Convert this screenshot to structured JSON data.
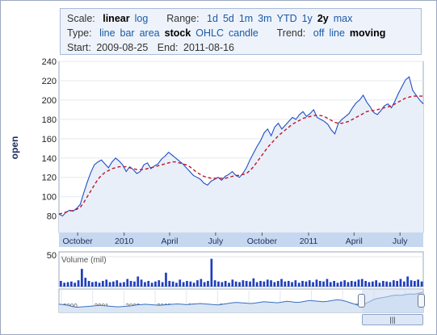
{
  "controls": {
    "scale": {
      "label": "Scale:",
      "options": [
        "linear",
        "log"
      ],
      "selected": "linear"
    },
    "range": {
      "label": "Range:",
      "options": [
        "1d",
        "5d",
        "1m",
        "3m",
        "YTD",
        "1y",
        "2y",
        "max"
      ],
      "selected": "2y"
    },
    "type": {
      "label": "Type:",
      "options": [
        "line",
        "bar",
        "area",
        "stock",
        "OHLC",
        "candle"
      ],
      "selected": "stock"
    },
    "trend": {
      "label": "Trend:",
      "options": [
        "off",
        "line",
        "moving"
      ],
      "selected": "moving"
    },
    "start": {
      "label": "Start:",
      "value": "2009-08-25"
    },
    "end": {
      "label": "End:",
      "value": "2011-08-16"
    }
  },
  "colors": {
    "price_line": "#1f4fc7",
    "price_fill": "#e9eff8",
    "trend_line": "#c0142c",
    "volume_bars": "#1f3fbf",
    "axis_band": "#c6d8f0",
    "navigator_line": "#3a6fc2",
    "navigator_fill": "#dbe6f5"
  },
  "chart_data": [
    {
      "type": "line",
      "title": "",
      "ylabel": "open",
      "ylim": [
        63,
        240
      ],
      "yticks": [
        80,
        100,
        120,
        140,
        160,
        180,
        200,
        220,
        240
      ],
      "xlim": [
        "2009-08-25",
        "2011-08-16"
      ],
      "xticks": [
        "October",
        "2010",
        "April",
        "July",
        "October",
        "2011",
        "April",
        "July"
      ],
      "x": [
        "2009-08-25",
        "2009-09-01",
        "2009-09-08",
        "2009-09-15",
        "2009-09-22",
        "2009-09-29",
        "2009-10-06",
        "2009-10-13",
        "2009-10-20",
        "2009-10-27",
        "2009-11-03",
        "2009-11-10",
        "2009-11-17",
        "2009-11-24",
        "2009-12-01",
        "2009-12-08",
        "2009-12-15",
        "2009-12-22",
        "2009-12-29",
        "2010-01-05",
        "2010-01-12",
        "2010-01-19",
        "2010-01-26",
        "2010-02-02",
        "2010-02-09",
        "2010-02-16",
        "2010-02-23",
        "2010-03-02",
        "2010-03-09",
        "2010-03-16",
        "2010-03-23",
        "2010-03-30",
        "2010-04-06",
        "2010-04-13",
        "2010-04-20",
        "2010-04-27",
        "2010-05-04",
        "2010-05-11",
        "2010-05-18",
        "2010-05-25",
        "2010-06-01",
        "2010-06-08",
        "2010-06-15",
        "2010-06-22",
        "2010-06-29",
        "2010-07-06",
        "2010-07-13",
        "2010-07-20",
        "2010-07-27",
        "2010-08-03",
        "2010-08-10",
        "2010-08-17",
        "2010-08-24",
        "2010-08-31",
        "2010-09-07",
        "2010-09-14",
        "2010-09-21",
        "2010-09-28",
        "2010-10-05",
        "2010-10-12",
        "2010-10-19",
        "2010-10-26",
        "2010-11-02",
        "2010-11-09",
        "2010-11-16",
        "2010-11-23",
        "2010-11-30",
        "2010-12-07",
        "2010-12-14",
        "2010-12-21",
        "2010-12-28",
        "2011-01-04",
        "2011-01-11",
        "2011-01-18",
        "2011-01-25",
        "2011-02-01",
        "2011-02-08",
        "2011-02-15",
        "2011-02-22",
        "2011-03-01",
        "2011-03-08",
        "2011-03-15",
        "2011-03-22",
        "2011-03-29",
        "2011-04-05",
        "2011-04-12",
        "2011-04-19",
        "2011-04-26",
        "2011-05-03",
        "2011-05-10",
        "2011-05-17",
        "2011-05-24",
        "2011-05-31",
        "2011-06-07",
        "2011-06-14",
        "2011-06-21",
        "2011-06-28",
        "2011-07-05",
        "2011-07-12",
        "2011-07-19",
        "2011-07-26",
        "2011-08-02",
        "2011-08-09",
        "2011-08-16"
      ],
      "series": [
        {
          "name": "",
          "role": "price",
          "values": [
            82,
            80,
            84,
            86,
            85,
            88,
            92,
            104,
            115,
            125,
            133,
            136,
            138,
            134,
            130,
            136,
            140,
            137,
            133,
            126,
            131,
            128,
            124,
            126,
            133,
            135,
            129,
            132,
            134,
            139,
            142,
            146,
            143,
            140,
            137,
            134,
            130,
            126,
            122,
            120,
            118,
            114,
            112,
            116,
            118,
            120,
            117,
            121,
            123,
            126,
            122,
            120,
            124,
            130,
            138,
            145,
            152,
            158,
            166,
            170,
            163,
            172,
            176,
            170,
            174,
            178,
            182,
            180,
            185,
            188,
            183,
            186,
            190,
            182,
            180,
            178,
            175,
            169,
            165,
            176,
            180,
            183,
            186,
            192,
            197,
            200,
            205,
            198,
            193,
            187,
            185,
            189,
            194,
            196,
            192,
            199,
            207,
            214,
            221,
            224,
            210,
            205,
            200,
            196
          ]
        },
        {
          "name": "",
          "role": "moving-average trend",
          "values": [
            82,
            83,
            84,
            85,
            86,
            87,
            89,
            94,
            100,
            106,
            112,
            118,
            122,
            125,
            127,
            129,
            130,
            131,
            131,
            131,
            130,
            129,
            128,
            128,
            128,
            129,
            130,
            131,
            132,
            133,
            134,
            135,
            136,
            136,
            135,
            134,
            133,
            131,
            128,
            125,
            123,
            121,
            120,
            119,
            119,
            119,
            119,
            119,
            120,
            121,
            122,
            122,
            123,
            124,
            127,
            131,
            136,
            141,
            146,
            151,
            155,
            159,
            163,
            166,
            169,
            172,
            175,
            177,
            179,
            181,
            182,
            183,
            184,
            184,
            184,
            183,
            181,
            179,
            177,
            176,
            176,
            177,
            178,
            180,
            182,
            184,
            186,
            188,
            189,
            189,
            190,
            191,
            192,
            193,
            194,
            196,
            198,
            200,
            202,
            203,
            204,
            204,
            204,
            204
          ]
        }
      ]
    },
    {
      "type": "bar",
      "title": "",
      "ylabel": "Volume (mil)",
      "ylim": [
        0,
        55
      ],
      "yticks": [
        50
      ],
      "x": [
        "2009-08-25",
        "2011-08-16"
      ],
      "series": [
        {
          "name": "Volume (mil)",
          "values": [
            9,
            6,
            7,
            8,
            6,
            10,
            28,
            14,
            9,
            7,
            8,
            6,
            9,
            11,
            7,
            8,
            10,
            6,
            7,
            12,
            9,
            8,
            16,
            11,
            7,
            9,
            6,
            8,
            10,
            7,
            22,
            9,
            8,
            6,
            11,
            7,
            9,
            8,
            6,
            10,
            12,
            7,
            9,
            44,
            10,
            8,
            7,
            9,
            6,
            11,
            8,
            7,
            10,
            9,
            8,
            13,
            7,
            9,
            8,
            11,
            10,
            7,
            9,
            12,
            8,
            9,
            7,
            10,
            6,
            9,
            8,
            10,
            7,
            11,
            9,
            8,
            12,
            7,
            9,
            6,
            8,
            10,
            7,
            9,
            8,
            11,
            12,
            9,
            7,
            8,
            10,
            6,
            9,
            8,
            7,
            10,
            9,
            12,
            8,
            16,
            10,
            9,
            11,
            8
          ]
        }
      ]
    },
    {
      "type": "area",
      "title": "",
      "ylabel": "",
      "xticks": [
        "2000",
        "2001",
        "2002",
        "2003",
        "2004",
        "2005",
        "2006",
        "2007",
        "2008",
        "2009",
        "2010",
        "2011"
      ],
      "series": [
        {
          "name": "",
          "values": [
            22,
            21,
            19,
            16,
            14,
            15,
            16,
            17,
            18,
            19,
            18,
            17,
            16,
            15,
            16,
            17,
            18,
            20,
            21,
            22,
            21,
            20,
            19,
            20,
            21,
            22,
            23,
            22,
            21,
            22,
            23,
            24,
            23,
            22,
            21,
            20,
            22,
            24,
            26,
            27,
            26,
            25,
            24,
            25,
            27,
            29,
            28,
            27,
            26,
            28,
            30,
            29,
            27,
            28,
            30,
            32,
            31,
            30,
            29,
            30,
            32,
            34,
            33,
            30,
            26,
            22,
            18,
            22,
            28,
            34,
            38,
            40,
            42,
            45,
            47,
            46,
            48,
            50,
            49,
            52,
            55
          ]
        }
      ]
    }
  ],
  "navigator": {
    "handle_label": "|||"
  }
}
